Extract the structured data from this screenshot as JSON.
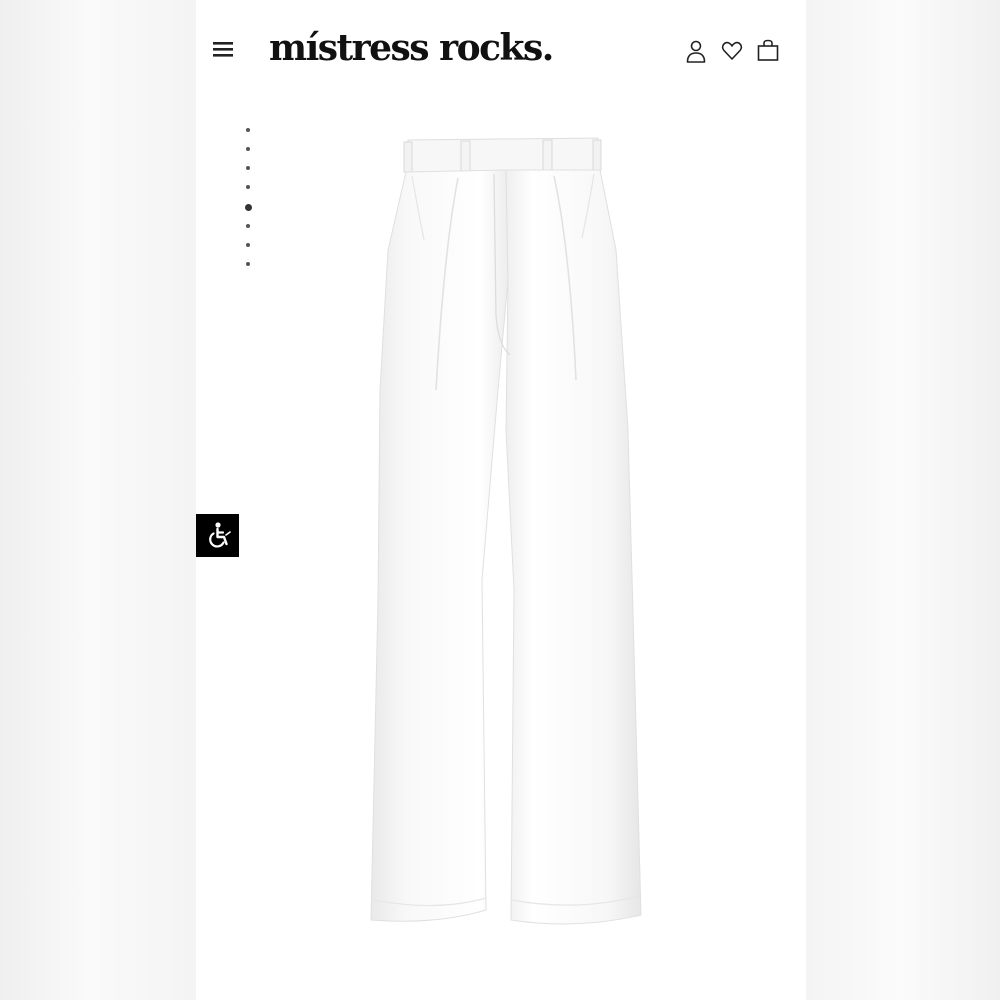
{
  "header": {
    "logo_text": "místress rocks.",
    "menu_icon": "hamburger-menu-icon",
    "account_icon": "user-icon",
    "wishlist_icon": "heart-icon",
    "cart_icon": "shopping-bag-icon"
  },
  "gallery": {
    "image_count": 8,
    "active_index": 5
  },
  "product": {
    "image_subject": "white-wide-leg-pleated-trousers"
  },
  "accessibility": {
    "icon": "wheelchair-accessibility-icon",
    "background": "#000000"
  },
  "colors": {
    "page_background": "#ffffff",
    "text": "#111111",
    "backdrop": "#f3f3f3"
  }
}
